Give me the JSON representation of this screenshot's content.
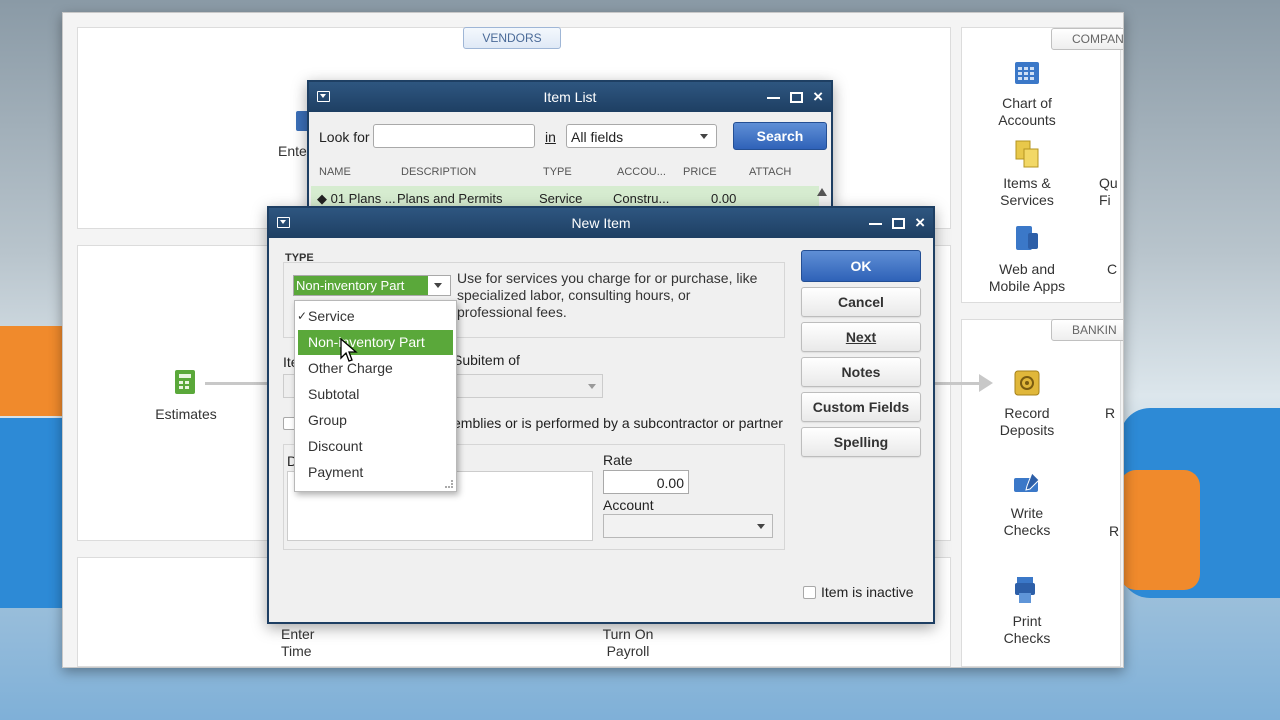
{
  "home_page": {
    "vendors_label": "VENDORS",
    "company_label": "COMPAN",
    "banking_label": "BANKIN",
    "enter_bills_partial": "Ente",
    "estimates_label": "Estimates",
    "enter_time_label": "Enter\nTime",
    "turn_on_payroll_label": "Turn On\nPayroll",
    "chart_of_accounts_label": "Chart of\nAccounts",
    "items_services_label": "Items &\nServices",
    "web_mobile_label": "Web and\nMobile Apps",
    "qu_partial": "Qu\nFi",
    "c_partial": "C",
    "record_deposits_label": "Record\nDeposits",
    "r_partial": "R",
    "write_checks_label": "Write\nChecks",
    "r2_partial": "R",
    "print_checks_label": "Print\nChecks"
  },
  "item_list": {
    "title": "Item List",
    "look_for_label": "Look for",
    "look_for_value": "",
    "in_label": "in",
    "in_value": "All fields",
    "search_button": "Search",
    "columns": [
      "NAME",
      "DESCRIPTION",
      "TYPE",
      "ACCOU...",
      "PRICE",
      "ATTACH"
    ],
    "rows": [
      {
        "name": "◆ 01 Plans ...",
        "description": "Plans and Permits",
        "type": "Service",
        "account": "Constru...",
        "price": "0.00",
        "attach": ""
      }
    ]
  },
  "new_item": {
    "title": "New Item",
    "type_section_label": "TYPE",
    "type_value": "Non-inventory Part",
    "type_description": "Use for services you charge for or purchase, like specialized labor, consulting hours, or professional fees.",
    "item_name_partial": "Ite",
    "subitem_of_label": "Subitem of",
    "subitem_of_value": "",
    "subcontractor_text": "emblies or is performed by a subcontractor or partner",
    "description_partial": "D",
    "rate_label": "Rate",
    "rate_value": "0.00",
    "account_label": "Account",
    "account_value": "",
    "item_inactive_label": "Item is inactive",
    "buttons": {
      "ok": "OK",
      "cancel": "Cancel",
      "next": "Next",
      "notes": "Notes",
      "custom_fields": "Custom Fields",
      "spelling": "Spelling"
    },
    "type_options": [
      {
        "label": "Service",
        "checked": true
      },
      {
        "label": "Non-inventory Part",
        "highlighted": true
      },
      {
        "label": "Other Charge"
      },
      {
        "label": "Subtotal"
      },
      {
        "label": "Group"
      },
      {
        "label": "Discount"
      },
      {
        "label": "Payment"
      }
    ],
    "check_mark": "✓"
  },
  "colors": {
    "titlebar": "#1e3f63",
    "highlight_green": "#5aa83a",
    "row_green": "#d6ecd0",
    "accent_blue": "#2f62b8"
  }
}
